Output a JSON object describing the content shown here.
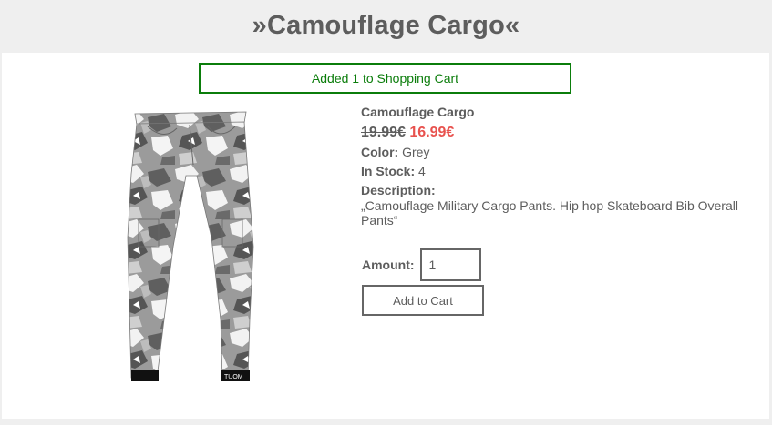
{
  "header": {
    "title": "»Camouflage Cargo«"
  },
  "notice": {
    "text": "Added 1 to Shopping Cart",
    "color": "#0b7d0b"
  },
  "product": {
    "image_icon": "camouflage-cargo-pants-image",
    "image_brand_text": "TUOM",
    "name": "Camouflage Cargo",
    "old_price": "19.99€",
    "new_price": "16.99€",
    "color_label": "Color:",
    "color_value": "Grey",
    "stock_label": "In Stock:",
    "stock_value": "4",
    "description_label": "Description:",
    "description": "„Camouflage Military Cargo Pants. Hip hop Skateboard Bib Overall Pants“"
  },
  "order": {
    "amount_label": "Amount:",
    "amount_value": "1",
    "add_button_label": "Add to Cart"
  },
  "colors": {
    "background": "#efefef",
    "text": "#5d5d5d",
    "sale_price": "#e8524e",
    "success": "#0b7d0b"
  }
}
